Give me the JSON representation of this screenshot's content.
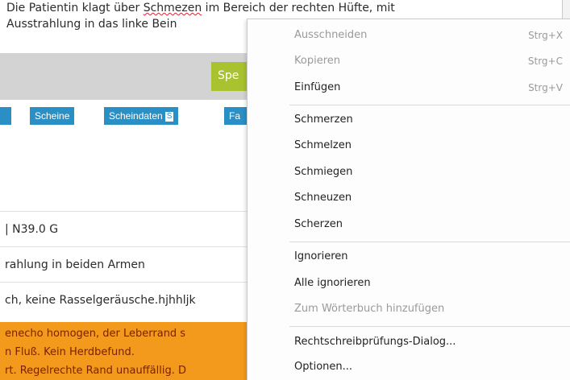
{
  "editor": {
    "line1_pre": "Die Patientin klagt über ",
    "misspelled_word": "Schmezen",
    "line1_post": " im Bereich der rechten Hüfte, mit",
    "line2": "Ausstrahlung in das linke Bein"
  },
  "toolbar": {
    "green_button_label": "Spe"
  },
  "tabs": [
    {
      "label": "Scheine"
    },
    {
      "label": "Scheindaten",
      "badge": "S"
    },
    {
      "label": "Fa"
    }
  ],
  "rows": [
    "| N39.0 G",
    "rahlung in beiden Armen",
    "ch, keine Rasselgeräusche.hjhhljk"
  ],
  "orange_text": [
    "enecho homogen, der  Leberrand s",
    "n Fluß. Kein Herdbefund.",
    "rt. Regelrechte Rand unauffällig. D"
  ],
  "context_menu": {
    "cut": {
      "label": "Ausschneiden",
      "shortcut": "Strg+X"
    },
    "copy": {
      "label": "Kopieren",
      "shortcut": "Strg+C"
    },
    "paste": {
      "label": "Einfügen",
      "shortcut": "Strg+V"
    },
    "suggestions": [
      "Schmerzen",
      "Schmelzen",
      "Schmiegen",
      "Schneuzen",
      "Scherzen"
    ],
    "ignore": "Ignorieren",
    "ignore_all": "Alle ignorieren",
    "add_to_dictionary": "Zum Wörterbuch hinzufügen",
    "spellcheck_dialog": "Rechtschreibprüfungs-Dialog...",
    "options": "Optionen..."
  },
  "colors": {
    "tab_blue": "#2a8fc4",
    "button_green": "#a9c22f",
    "warning_orange": "#f39a1d"
  }
}
